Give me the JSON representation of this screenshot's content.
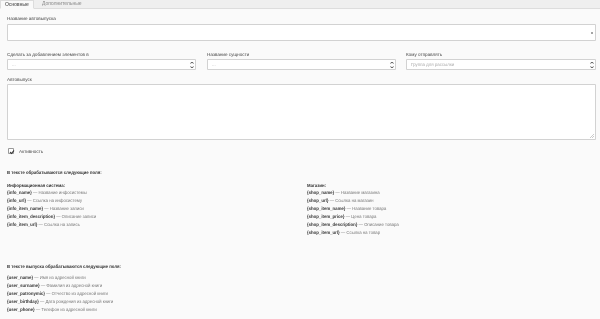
{
  "tabs": [
    {
      "label": "Основные"
    },
    {
      "label": "Дополнительные"
    }
  ],
  "form": {
    "name_label": "Название автовыпуска",
    "name_value": "",
    "after_label": "Сделать за добавлением элементов в",
    "after_value": "...",
    "entity_label": "Название сущности",
    "entity_value": "...",
    "send_label": "Кому отправлять",
    "send_placeholder": "Группа для рассылки",
    "auto_label": "Автовыпуск",
    "auto_value": "",
    "active_label": "Активность",
    "active_checked": true
  },
  "help": {
    "title1": "В тексте обрабатываются следующие поля:",
    "info_title": "Информационная система:",
    "info_fields": [
      {
        "key": "{info_name}",
        "desc": " — Название инфосистемы"
      },
      {
        "key": "{info_url}",
        "desc": " — Ссылка на инфосистему"
      },
      {
        "key": "{info_item_name}",
        "desc": " — Название записи"
      },
      {
        "key": "{info_item_description}",
        "desc": " — Описание записи"
      },
      {
        "key": "{info_item_url}",
        "desc": " — Ссылка на запись"
      }
    ],
    "shop_title": "Магазин:",
    "shop_fields": [
      {
        "key": "{shop_name}",
        "desc": " — Название магазина"
      },
      {
        "key": "{shop_url}",
        "desc": " — Ссылка на магазин"
      },
      {
        "key": "{shop_item_name}",
        "desc": " — Название товара"
      },
      {
        "key": "{shop_item_price}",
        "desc": " — Цена товара"
      },
      {
        "key": "{shop_item_description}",
        "desc": " — Описание товара"
      },
      {
        "key": "{shop_item_url}",
        "desc": " — Ссылка на товар"
      }
    ],
    "title2": "В тексте выпуска обрабатываются следующие поля:",
    "user_fields": [
      {
        "key": "{user_name}",
        "desc": " — Имя из адресной книги"
      },
      {
        "key": "{user_surname}",
        "desc": " — Фамилия из адресной книги"
      },
      {
        "key": "{user_patronymic}",
        "desc": " — Отчество из адресной книги"
      },
      {
        "key": "{user_birthday}",
        "desc": " — Дата рождения из адресной книги"
      },
      {
        "key": "{user_phone}",
        "desc": " — Телефон из адресной книги"
      }
    ]
  }
}
